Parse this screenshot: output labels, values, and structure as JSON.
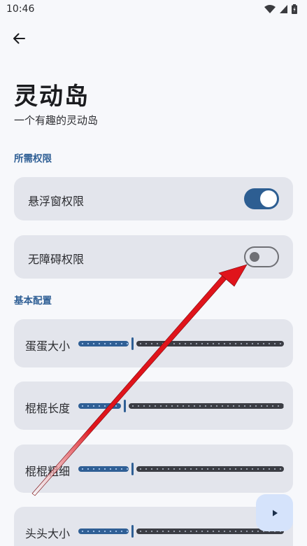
{
  "status_bar": {
    "time": "10:46"
  },
  "header": {
    "title": "灵动岛",
    "subtitle": "一个有趣的灵动岛"
  },
  "permissions": {
    "section_title": "所需权限",
    "items": [
      {
        "label": "悬浮窗权限",
        "enabled": true
      },
      {
        "label": "无障碍权限",
        "enabled": false
      }
    ]
  },
  "config": {
    "section_title": "基本配置",
    "items": [
      {
        "label": "蛋蛋大小",
        "level": 0.26
      },
      {
        "label": "棍棍长度",
        "level": 0.22
      },
      {
        "label": "棍棍粗细",
        "level": 0.26
      },
      {
        "label": "头头大小",
        "level": 0.26
      }
    ]
  },
  "fab": {
    "icon": "play-icon"
  },
  "colors": {
    "accent": "#2f5f95",
    "card": "#e3e5ec",
    "annotation_arrow": "#e0141b"
  }
}
